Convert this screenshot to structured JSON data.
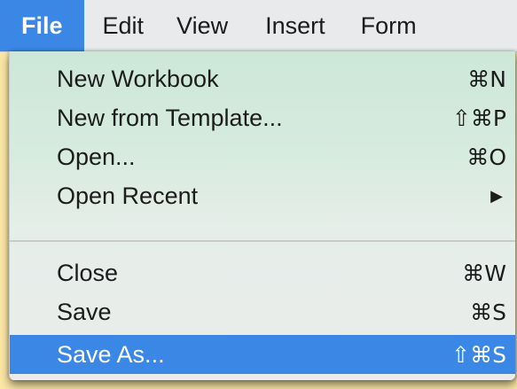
{
  "menubar": {
    "items": [
      {
        "label": "File"
      },
      {
        "label": "Edit"
      },
      {
        "label": "View"
      },
      {
        "label": "Insert"
      },
      {
        "label": "Form"
      }
    ]
  },
  "file_menu": {
    "items": [
      {
        "label": "New Workbook",
        "shortcut": "⌘N"
      },
      {
        "label": "New from Template...",
        "shortcut": "⇧⌘P"
      },
      {
        "label": "Open...",
        "shortcut": "⌘O"
      },
      {
        "label": "Open Recent",
        "submenu_arrow": "▶"
      },
      {
        "label": "Close",
        "shortcut": "⌘W"
      },
      {
        "label": "Save",
        "shortcut": "⌘S"
      },
      {
        "label": "Save As...",
        "shortcut": "⇧⌘S"
      }
    ],
    "highlighted_item": "Save As..."
  },
  "colors": {
    "selection": "#3a87e6",
    "background": "#fce7a6",
    "menubar": "#e9eaec",
    "menu_top": "#cce7d8"
  }
}
